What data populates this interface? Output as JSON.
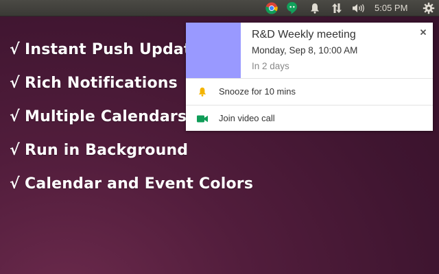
{
  "panel": {
    "clock": "5:05 PM",
    "tray_icons": [
      "chrome-icon",
      "hangouts-icon",
      "bell-icon",
      "network-transfer-icon",
      "volume-icon",
      "gear-icon"
    ]
  },
  "features": [
    {
      "tick": "√",
      "label": "Instant Push Update"
    },
    {
      "tick": "√",
      "label": "Rich Notifications"
    },
    {
      "tick": "√",
      "label": "Multiple Calendars"
    },
    {
      "tick": "√",
      "label": "Run in Background"
    },
    {
      "tick": "√",
      "label": "Calendar and Event Colors"
    }
  ],
  "notification": {
    "title": "R&D Weekly meeting",
    "datetime": "Monday, Sep 8, 10:00 AM",
    "relative": "In 2 days",
    "close_glyph": "×",
    "color": "#9999ff",
    "actions": [
      {
        "label": "Snooze for 10 mins",
        "icon": "bell-icon",
        "icon_color": "#f4b400"
      },
      {
        "label": "Join video call",
        "icon": "video-camera-icon",
        "icon_color": "#0f9d58"
      }
    ]
  }
}
